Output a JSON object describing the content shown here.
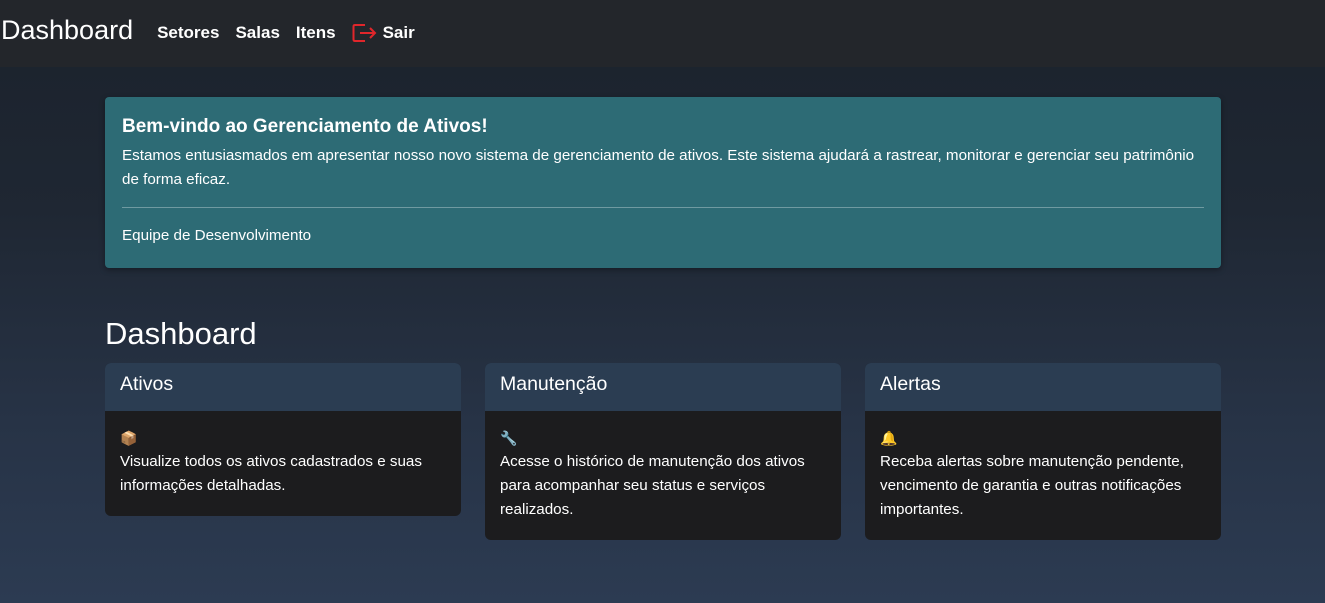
{
  "navbar": {
    "brand": "Dashboard",
    "links": [
      {
        "label": "Setores"
      },
      {
        "label": "Salas"
      },
      {
        "label": "Itens"
      }
    ],
    "logout": {
      "label": "Sair",
      "icon": "logout-icon",
      "icon_color": "#e0262b"
    }
  },
  "welcome": {
    "title": "Bem-vindo ao Gerenciamento de Ativos!",
    "text": "Estamos entusiasmados em apresentar nosso novo sistema de gerenciamento de ativos. Este sistema ajudará a rastrear, monitorar e gerenciar seu patrimônio de forma eficaz.",
    "signature": "Equipe de Desenvolvimento",
    "background": "#2d6b75"
  },
  "dashboard": {
    "title": "Dashboard",
    "cards": [
      {
        "title": "Ativos",
        "icon": "package-icon",
        "icon_glyph": "📦",
        "text": "Visualize todos os ativos cadastrados e suas informações detalhadas."
      },
      {
        "title": "Manutenção",
        "icon": "wrench-icon",
        "icon_glyph": "🔧",
        "text": "Acesse o histórico de manutenção dos ativos para acompanhar seu status e serviços realizados."
      },
      {
        "title": "Alertas",
        "icon": "bell-icon",
        "icon_glyph": "🔔",
        "text": "Receba alertas sobre manutenção pendente, vencimento de garantia e outras notificações importantes."
      }
    ]
  }
}
